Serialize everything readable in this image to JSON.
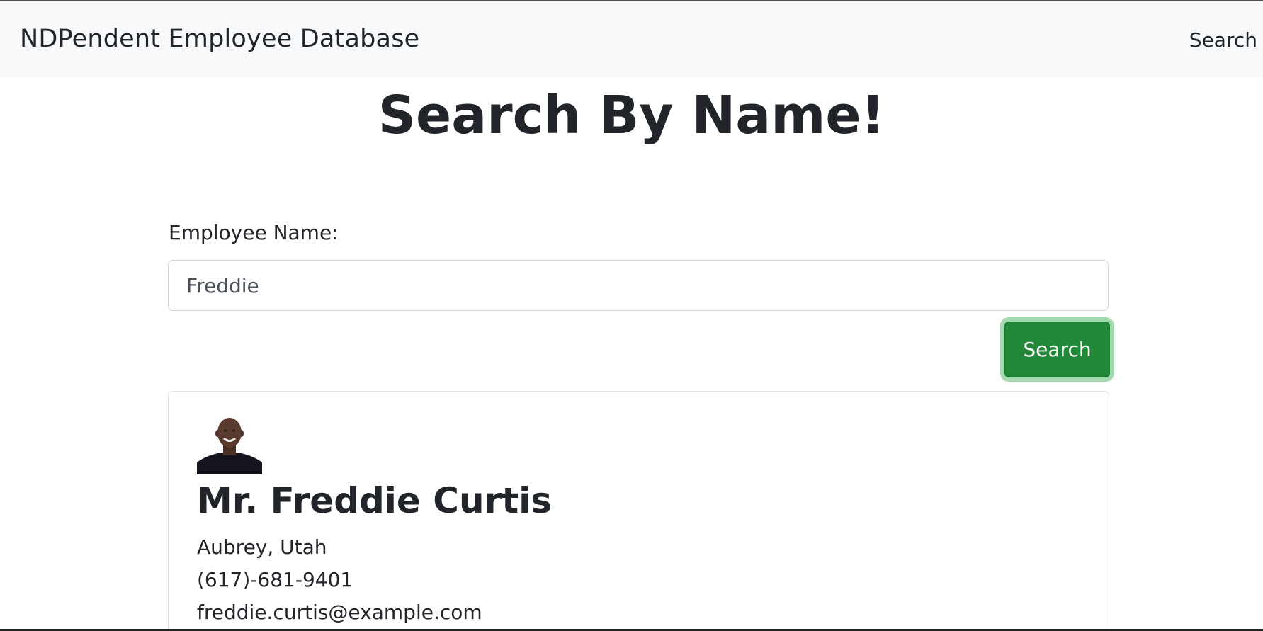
{
  "navbar": {
    "brand": "NDPendent Employee Database",
    "search_link": "Search"
  },
  "main": {
    "title": "Search By Name!",
    "employee_label": "Employee Name:",
    "name_input_value": "Freddie",
    "search_button": "Search"
  },
  "result": {
    "name": "Mr. Freddie Curtis",
    "location": "Aubrey, Utah",
    "phone": "(617)-681-9401",
    "email": "freddie.curtis@example.com",
    "avatar_icon": "person-photo"
  },
  "colors": {
    "navbar_bg": "#f8f9fa",
    "search_button_bg": "#218838",
    "text": "#212529"
  }
}
